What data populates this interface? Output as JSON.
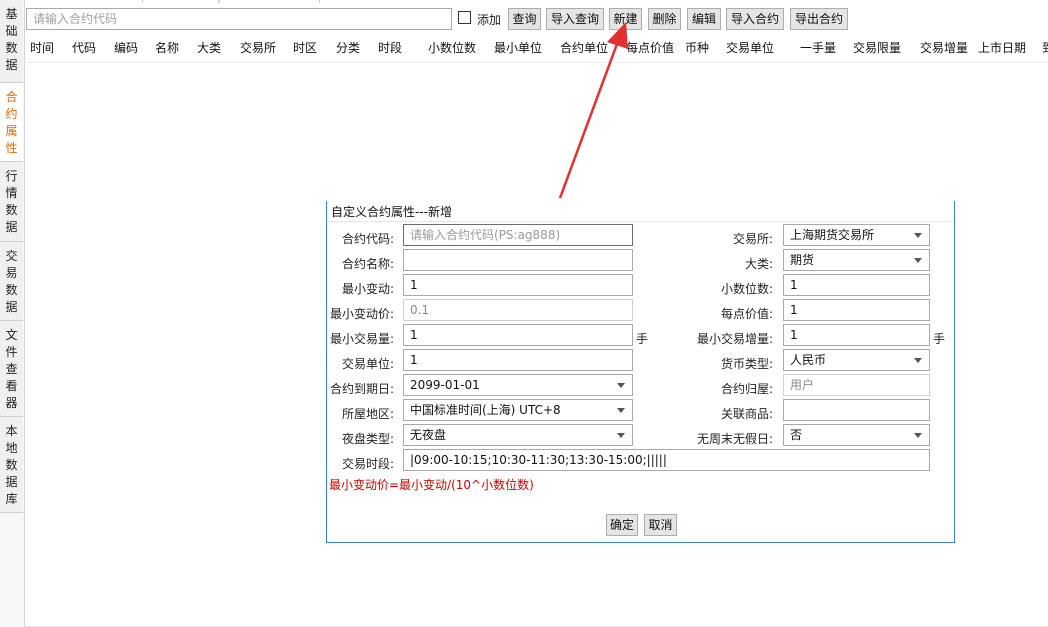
{
  "sidebar": {
    "tabs": [
      {
        "label": "基础数据",
        "active": false
      },
      {
        "label": "合约属性",
        "active": true
      },
      {
        "label": "行情数据",
        "active": false
      },
      {
        "label": "交易数据",
        "active": false
      },
      {
        "label": "文件查看器",
        "active": false
      },
      {
        "label": "本地数据库",
        "active": false
      }
    ]
  },
  "toolbar": {
    "search_placeholder": "请输入合约代码",
    "add_checkbox_label": "添加",
    "buttons": {
      "query": "查询",
      "import_query": "导入查询",
      "new": "新建",
      "delete": "删除",
      "edit": "编辑",
      "import_contract": "导入合约",
      "export_contract": "导出合约"
    }
  },
  "table": {
    "columns": [
      "时间",
      "代码",
      "编码",
      "名称",
      "大类",
      "交易所",
      "时区",
      "分类",
      "时段",
      "小数位数",
      "最小单位",
      "合约单位",
      "每点价值",
      "币种",
      "交易单位",
      "一手量",
      "交易限量",
      "交易增量",
      "上市日期",
      "到"
    ]
  },
  "dialog": {
    "title": "自定义合约属性---新增",
    "contract_code": {
      "label": "合约代码:",
      "placeholder": "请输入合约代码(PS:ag888)"
    },
    "contract_name": {
      "label": "合约名称:",
      "value": ""
    },
    "min_change": {
      "label": "最小变动:",
      "value": "1"
    },
    "min_change_price": {
      "label": "最小变动价:",
      "value": "0.1"
    },
    "min_trade_qty": {
      "label": "最小交易量:",
      "value": "1",
      "unit": "手"
    },
    "trade_unit": {
      "label": "交易单位:",
      "value": "1"
    },
    "expiry_date": {
      "label": "合约到期日:",
      "value": "2099-01-01"
    },
    "region": {
      "label": "所屋地区:",
      "value": "中国标准时间(上海) UTC+8"
    },
    "night_type": {
      "label": "夜盘类型:",
      "value": "无夜盘"
    },
    "trading_session": {
      "label": "交易时段:",
      "value": "|09:00-10:15;10:30-11:30;13:30-15:00;|||||"
    },
    "exchange": {
      "label": "交易所:",
      "value": "上海期货交易所"
    },
    "category": {
      "label": "大类:",
      "value": "期货"
    },
    "decimal_places": {
      "label": "小数位数:",
      "value": "1"
    },
    "point_value": {
      "label": "每点价值:",
      "value": "1"
    },
    "min_trade_increment": {
      "label": "最小交易增量:",
      "value": "1",
      "unit": "手"
    },
    "currency": {
      "label": "货币类型:",
      "value": "人民币"
    },
    "ownership": {
      "label": "合约归屋:",
      "value": "用户"
    },
    "related_product": {
      "label": "关联商品:",
      "value": ""
    },
    "no_weekend_holiday": {
      "label": "无周末无假日:",
      "value": "否"
    },
    "formula": "最小变动价=最小变动/(10^小数位数)",
    "confirm_label": "确定",
    "cancel_label": "取消"
  },
  "colors": {
    "active_tab_text": "#e06a00",
    "dialog_border": "#3c7fd1",
    "annotation_arrow": "#e03030",
    "formula_text": "#d00000"
  }
}
